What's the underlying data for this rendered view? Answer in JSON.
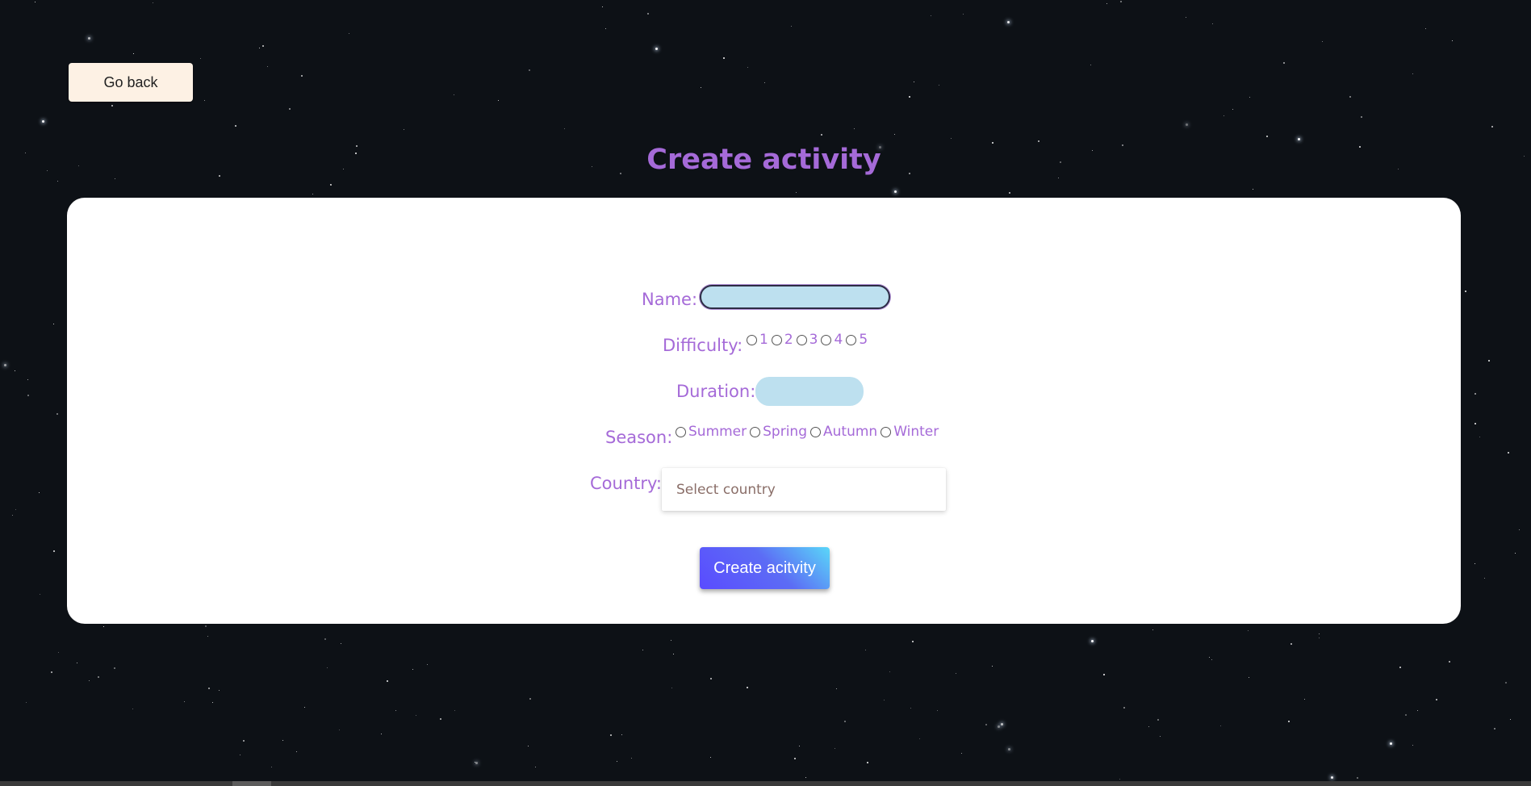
{
  "nav": {
    "go_back_label": "Go back"
  },
  "page": {
    "title": "Create activity"
  },
  "form": {
    "name_label": "Name:",
    "name_value": "",
    "difficulty_label": "Difficulty:",
    "difficulty_options": [
      "1",
      "2",
      "3",
      "4",
      "5"
    ],
    "duration_label": "Duration:",
    "duration_value": "",
    "season_label": "Season:",
    "season_options": [
      "Summer",
      "Spring",
      "Autumn",
      "Winter"
    ],
    "country_label": "Country:",
    "country_placeholder": "Select country",
    "submit_label": "Create acitvity"
  },
  "colors": {
    "accent": "#a56ad8",
    "input_bg": "#bde0ef",
    "button_gradient_start": "#5a4bff",
    "button_gradient_end": "#5ad7f8",
    "back_button_bg": "#fdf1e4"
  }
}
